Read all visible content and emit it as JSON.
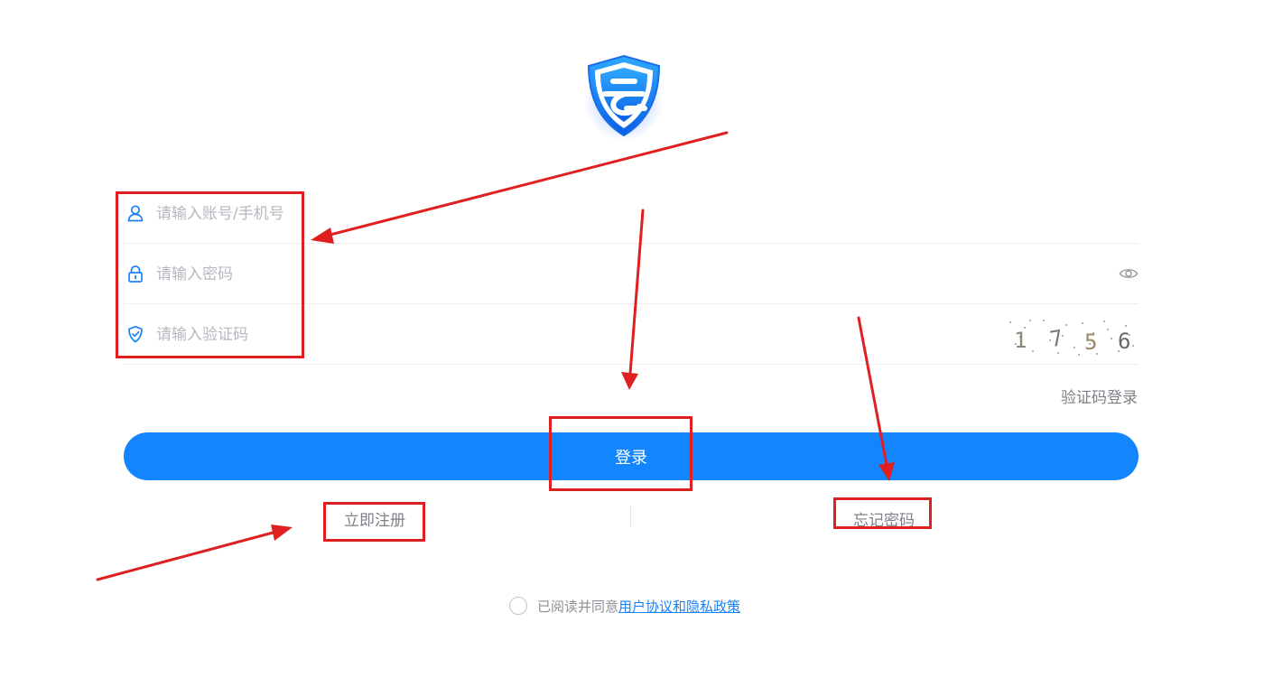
{
  "login": {
    "account_placeholder": "请输入账号/手机号",
    "password_placeholder": "请输入密码",
    "captcha_placeholder": "请输入验证码",
    "captcha_chars": [
      "1",
      "7",
      "5",
      "6"
    ],
    "switch_login_label": "验证码登录",
    "login_button_label": "登录",
    "register_label": "立即注册",
    "forgot_label": "忘记密码",
    "agreement_text": "已阅读并同意",
    "agreement_link": "用户协议和隐私政策"
  },
  "colors": {
    "primary": "#1385ff",
    "annotation": "#e02020",
    "placeholder": "#b5b8bf",
    "link": "#1a82f5"
  },
  "icons": [
    "user-icon",
    "lock-icon",
    "shield-check-icon",
    "eye-icon",
    "app-logo"
  ]
}
